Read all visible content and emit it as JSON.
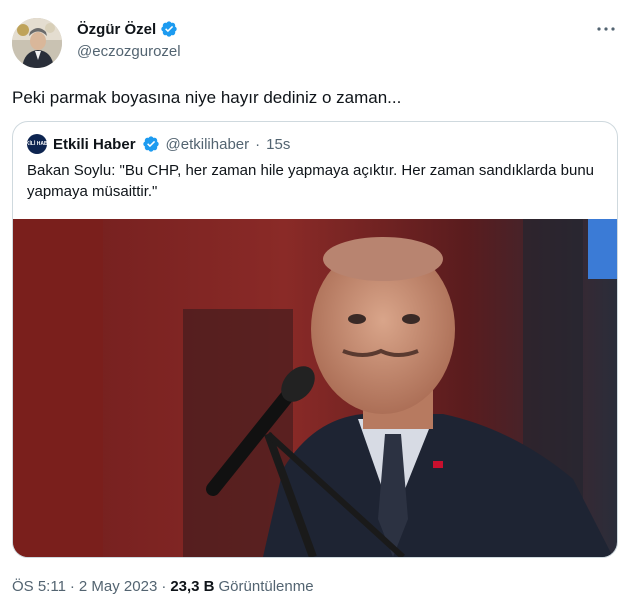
{
  "author": {
    "name": "Özgür Özel",
    "handle": "@eczozgurozel",
    "verified": true
  },
  "tweet": {
    "text": "Peki parmak boyasına niye hayır dediniz o zaman..."
  },
  "quote": {
    "avatar_label": "ETKİLİ HABER",
    "name": "Etkili Haber",
    "handle": "@etkilihaber",
    "separator": "·",
    "time": "15s",
    "text": "Bakan Soylu: \"Bu CHP, her zaman hile yapmaya açıktır. Her zaman sandıklarda bunu yapmaya müsaittir.\""
  },
  "meta": {
    "time": "ÖS 5:11",
    "separator1": "·",
    "date": "2 May 2023",
    "separator2": "·",
    "views_count": "23,3 B",
    "views_label": "Görüntülenme"
  },
  "colors": {
    "verified": "#1d9bf0",
    "secondary_text": "#536471",
    "border": "#cfd9de"
  }
}
